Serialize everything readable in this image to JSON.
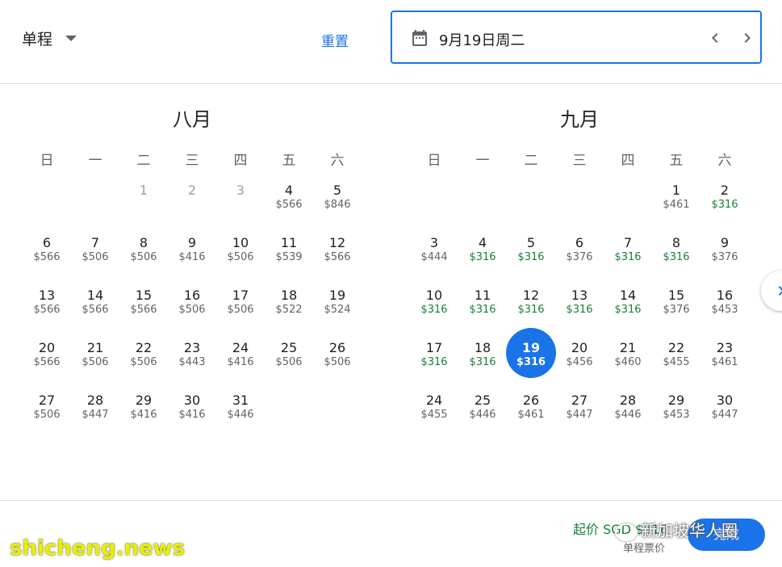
{
  "header": {
    "trip_type": "单程",
    "reset_label": "重置",
    "date_value": "9月19日周二"
  },
  "weekdays": [
    "日",
    "一",
    "二",
    "三",
    "四",
    "五",
    "六"
  ],
  "months": [
    {
      "title": "八月",
      "days": [
        {
          "day": "",
          "price": ""
        },
        {
          "day": "",
          "price": ""
        },
        {
          "day": "1",
          "price": "",
          "past": true
        },
        {
          "day": "2",
          "price": "",
          "past": true
        },
        {
          "day": "3",
          "price": "",
          "past": true
        },
        {
          "day": "4",
          "price": "$566"
        },
        {
          "day": "5",
          "price": "$846"
        },
        {
          "day": "6",
          "price": "$566"
        },
        {
          "day": "7",
          "price": "$506"
        },
        {
          "day": "8",
          "price": "$506"
        },
        {
          "day": "9",
          "price": "$416"
        },
        {
          "day": "10",
          "price": "$506"
        },
        {
          "day": "11",
          "price": "$539"
        },
        {
          "day": "12",
          "price": "$566"
        },
        {
          "day": "13",
          "price": "$566"
        },
        {
          "day": "14",
          "price": "$566"
        },
        {
          "day": "15",
          "price": "$566"
        },
        {
          "day": "16",
          "price": "$506"
        },
        {
          "day": "17",
          "price": "$506"
        },
        {
          "day": "18",
          "price": "$522"
        },
        {
          "day": "19",
          "price": "$524"
        },
        {
          "day": "20",
          "price": "$566"
        },
        {
          "day": "21",
          "price": "$506"
        },
        {
          "day": "22",
          "price": "$506"
        },
        {
          "day": "23",
          "price": "$443"
        },
        {
          "day": "24",
          "price": "$416"
        },
        {
          "day": "25",
          "price": "$506"
        },
        {
          "day": "26",
          "price": "$506"
        },
        {
          "day": "27",
          "price": "$506"
        },
        {
          "day": "28",
          "price": "$447"
        },
        {
          "day": "29",
          "price": "$416"
        },
        {
          "day": "30",
          "price": "$416"
        },
        {
          "day": "31",
          "price": "$446"
        }
      ]
    },
    {
      "title": "九月",
      "days": [
        {
          "day": "",
          "price": ""
        },
        {
          "day": "",
          "price": ""
        },
        {
          "day": "",
          "price": ""
        },
        {
          "day": "",
          "price": ""
        },
        {
          "day": "",
          "price": ""
        },
        {
          "day": "1",
          "price": "$461"
        },
        {
          "day": "2",
          "price": "$316",
          "low": true
        },
        {
          "day": "3",
          "price": "$444"
        },
        {
          "day": "4",
          "price": "$316",
          "low": true
        },
        {
          "day": "5",
          "price": "$316",
          "low": true
        },
        {
          "day": "6",
          "price": "$376"
        },
        {
          "day": "7",
          "price": "$316",
          "low": true
        },
        {
          "day": "8",
          "price": "$316",
          "low": true
        },
        {
          "day": "9",
          "price": "$376"
        },
        {
          "day": "10",
          "price": "$316",
          "low": true
        },
        {
          "day": "11",
          "price": "$316",
          "low": true
        },
        {
          "day": "12",
          "price": "$316",
          "low": true
        },
        {
          "day": "13",
          "price": "$316",
          "low": true
        },
        {
          "day": "14",
          "price": "$316",
          "low": true
        },
        {
          "day": "15",
          "price": "$376"
        },
        {
          "day": "16",
          "price": "$453"
        },
        {
          "day": "17",
          "price": "$316",
          "low": true
        },
        {
          "day": "18",
          "price": "$316",
          "low": true
        },
        {
          "day": "19",
          "price": "$316",
          "low": true,
          "selected": true
        },
        {
          "day": "20",
          "price": "$456"
        },
        {
          "day": "21",
          "price": "$460"
        },
        {
          "day": "22",
          "price": "$455"
        },
        {
          "day": "23",
          "price": "$461"
        },
        {
          "day": "24",
          "price": "$455"
        },
        {
          "day": "25",
          "price": "$446"
        },
        {
          "day": "26",
          "price": "$461"
        },
        {
          "day": "27",
          "price": "$447"
        },
        {
          "day": "28",
          "price": "$446"
        },
        {
          "day": "29",
          "price": "$453"
        },
        {
          "day": "30",
          "price": "$447"
        }
      ]
    }
  ],
  "footer": {
    "starting_price": "起价 SGD $316",
    "fare_note": "单程票价",
    "done_label": "完成"
  },
  "watermarks": {
    "wechat": "新加坡华人圈",
    "site": "shicheng.news"
  },
  "colors": {
    "accent": "#1a73e8",
    "low_price": "#188038",
    "text": "#202124",
    "muted": "#5f6368"
  }
}
